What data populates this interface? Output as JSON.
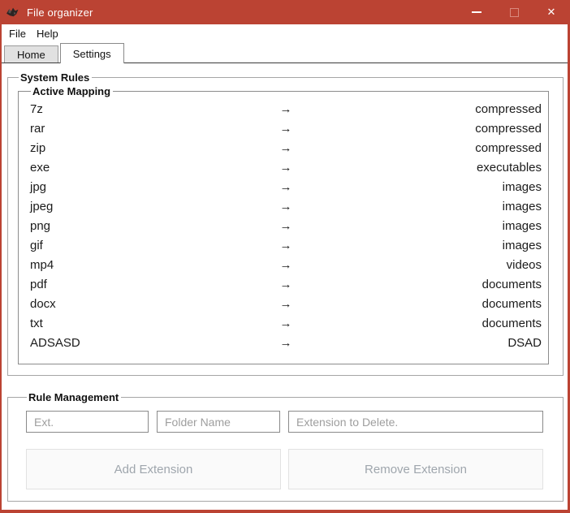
{
  "window": {
    "title": "File organizer",
    "controls": {
      "minimize_icon": "minimize-bar",
      "maximize_icon": "maximize-box",
      "close_glyph": "✕"
    }
  },
  "menubar": {
    "items": [
      {
        "label": "File"
      },
      {
        "label": "Help"
      }
    ]
  },
  "tabs": [
    {
      "label": "Home",
      "active": false
    },
    {
      "label": "Settings",
      "active": true
    }
  ],
  "system_rules": {
    "label": "System Rules",
    "active_mapping": {
      "label": "Active Mapping",
      "arrow_glyph": "→",
      "rows": [
        {
          "ext": "7z",
          "category": "compressed"
        },
        {
          "ext": "rar",
          "category": "compressed"
        },
        {
          "ext": "zip",
          "category": "compressed"
        },
        {
          "ext": "exe",
          "category": "executables"
        },
        {
          "ext": "jpg",
          "category": "images"
        },
        {
          "ext": "jpeg",
          "category": "images"
        },
        {
          "ext": "png",
          "category": "images"
        },
        {
          "ext": "gif",
          "category": "images"
        },
        {
          "ext": "mp4",
          "category": "videos"
        },
        {
          "ext": "pdf",
          "category": "documents"
        },
        {
          "ext": "docx",
          "category": "documents"
        },
        {
          "ext": "txt",
          "category": "documents"
        },
        {
          "ext": "ADSASD",
          "category": "DSAD"
        }
      ]
    }
  },
  "rule_management": {
    "label": "Rule Management",
    "ext_input": {
      "placeholder": "Ext.",
      "value": ""
    },
    "folder_input": {
      "placeholder": "Folder Name",
      "value": ""
    },
    "delete_input": {
      "placeholder": "Extension to Delete.",
      "value": ""
    },
    "add_button": "Add Extension",
    "remove_button": "Remove Extension"
  },
  "colors": {
    "titlebar": "#BB4333",
    "tab_inactive_bg": "#E1E1E1",
    "placeholder": "#9E9E9E",
    "button_text": "#9FA6AD"
  }
}
